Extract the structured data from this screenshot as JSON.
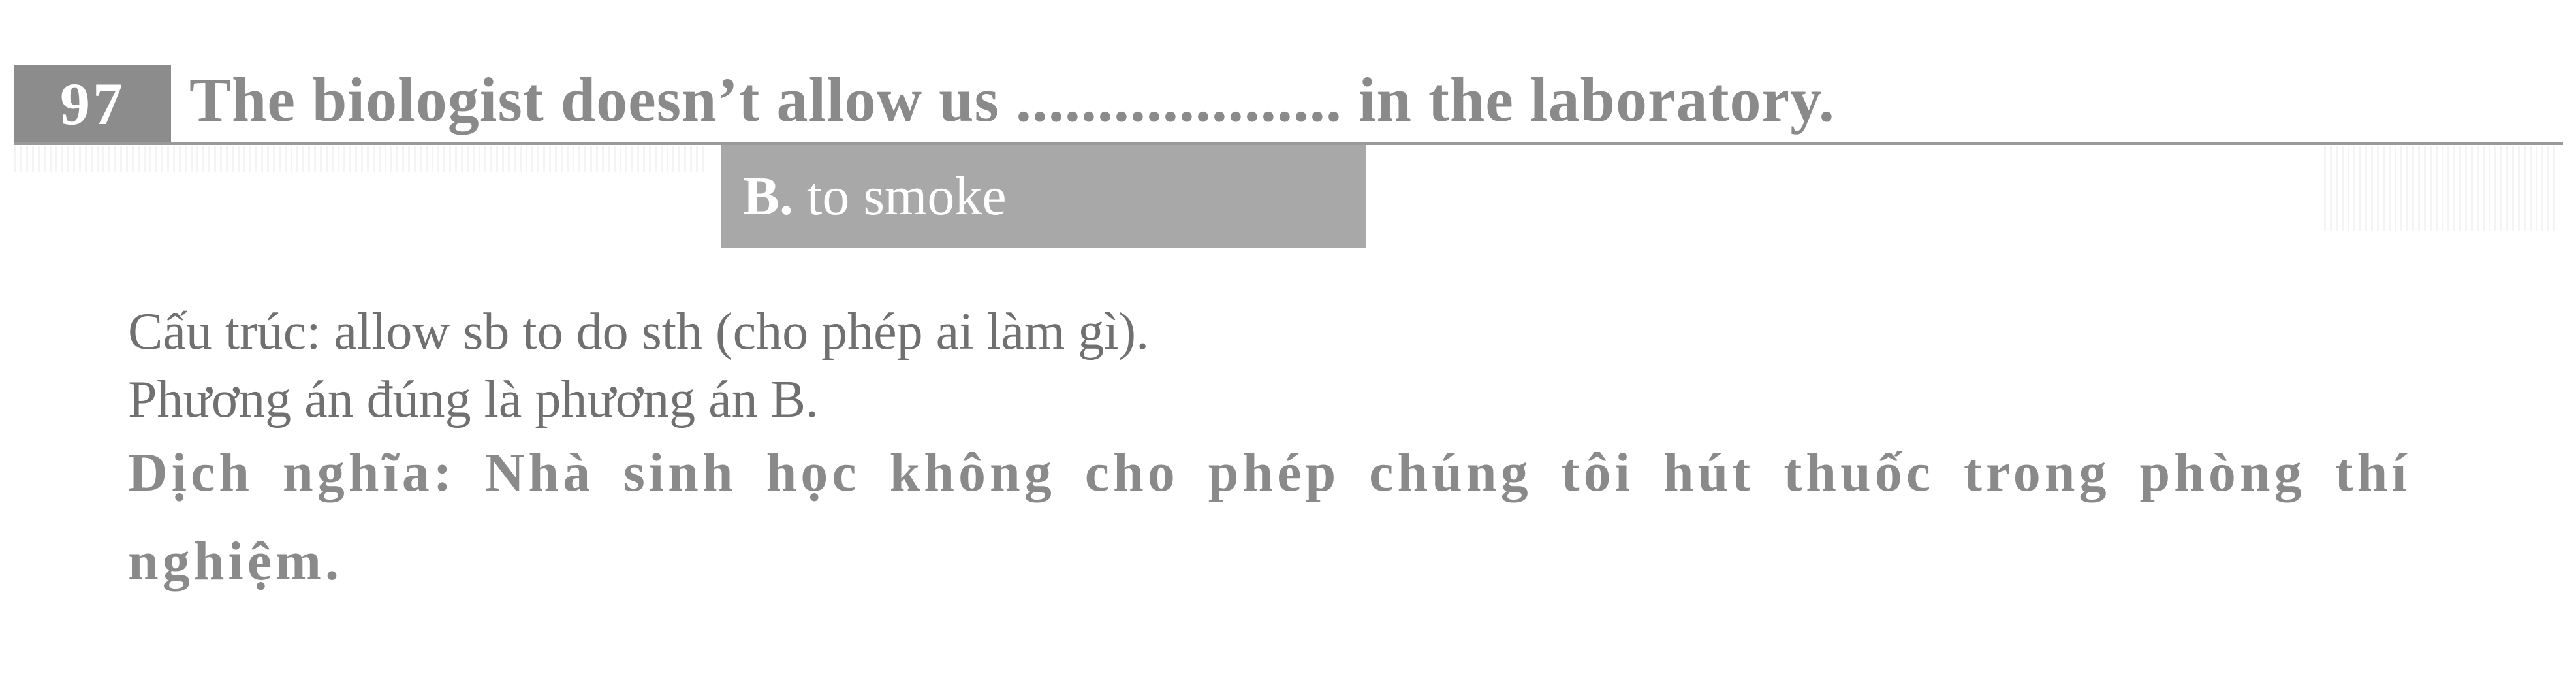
{
  "question": {
    "number": "97",
    "text": "The biologist doesn’t allow us .................... in the laboratory."
  },
  "answer": {
    "letter": "B.",
    "text": " to smoke"
  },
  "explanation": {
    "structure": "Cấu trúc: allow sb to do sth (cho phép ai làm gì).",
    "correct_option": "Phương án đúng là phương án B.",
    "translation": "Dịch nghĩa: Nhà sinh học không cho phép chúng tôi hút thuốc trong phòng thí nghiệm."
  }
}
